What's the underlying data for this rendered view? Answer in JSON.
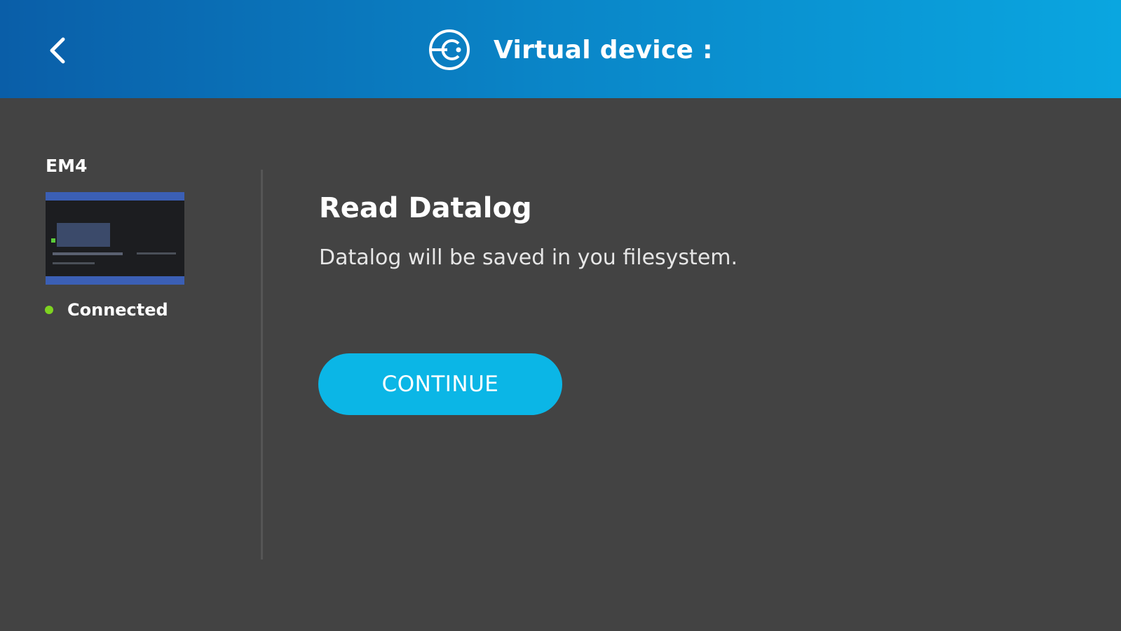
{
  "header": {
    "title": "Virtual device :",
    "back_icon": "chevron-left-icon",
    "logo_icon": "device-logo-icon"
  },
  "sidebar": {
    "device_name": "EM4",
    "thumbnail": "device-thumbnail",
    "status": {
      "text": "Connected",
      "color": "#7ed321"
    }
  },
  "main": {
    "title": "Read Datalog",
    "description": "Datalog will be saved in you filesystem.",
    "continue_label": "CONTINUE"
  },
  "colors": {
    "header_gradient_start": "#0a5ea8",
    "header_gradient_end": "#0aa6e0",
    "background": "#434343",
    "accent": "#0bb6e6"
  }
}
